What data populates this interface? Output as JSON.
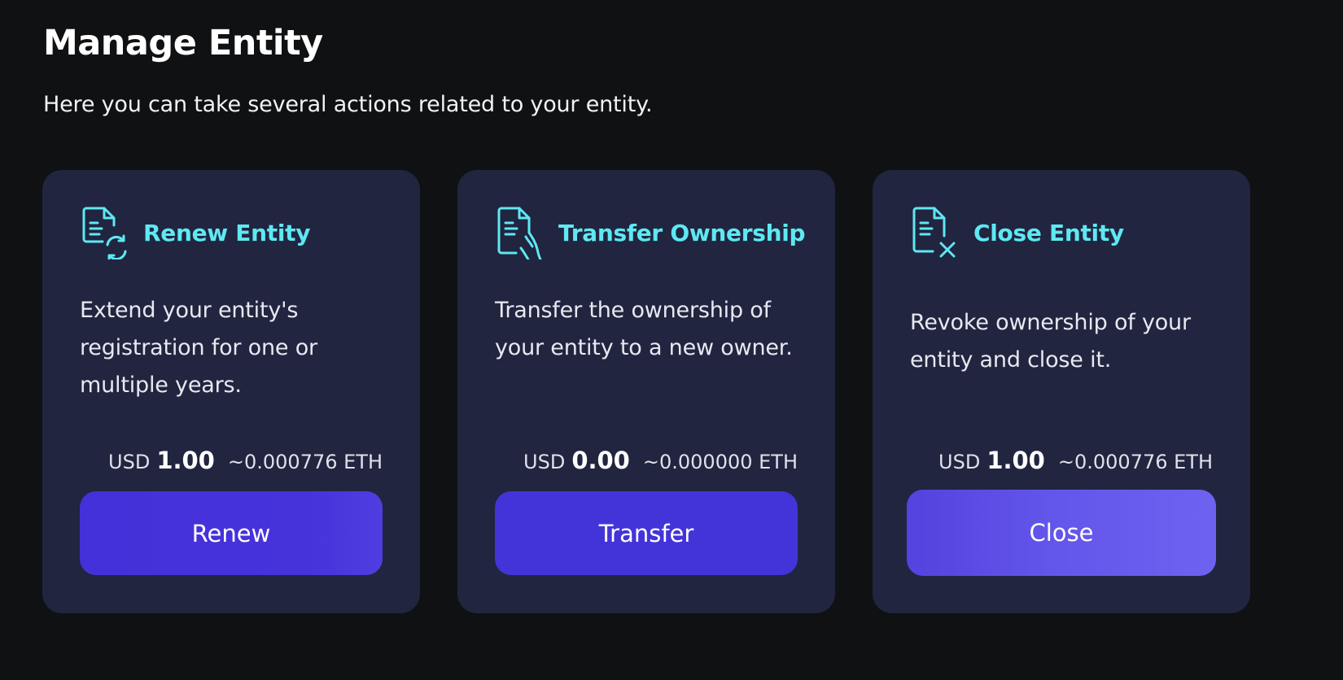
{
  "header": {
    "title": "Manage Entity",
    "subtitle": "Here you can take several actions related to your entity."
  },
  "colors": {
    "background": "#101113",
    "card": "#21253f",
    "accent": "#5ee8f2",
    "button": "#4334da"
  },
  "cards": [
    {
      "icon": "document-renew-icon",
      "title": "Renew Entity",
      "description": "Extend your entity's registration for one or multiple years.",
      "price": {
        "currency": "USD",
        "value": "1.00",
        "eth": "~0.000776 ETH"
      },
      "button_label": "Renew"
    },
    {
      "icon": "document-transfer-icon",
      "title": "Transfer Ownership",
      "description": "Transfer the ownership of your entity to a new owner.",
      "price": {
        "currency": "USD",
        "value": "0.00",
        "eth": "~0.000000 ETH"
      },
      "button_label": "Transfer"
    },
    {
      "icon": "document-close-icon",
      "title": "Close Entity",
      "description": "Revoke ownership of your entity and close it.",
      "price": {
        "currency": "USD",
        "value": "1.00",
        "eth": "~0.000776 ETH"
      },
      "button_label": "Close"
    }
  ]
}
